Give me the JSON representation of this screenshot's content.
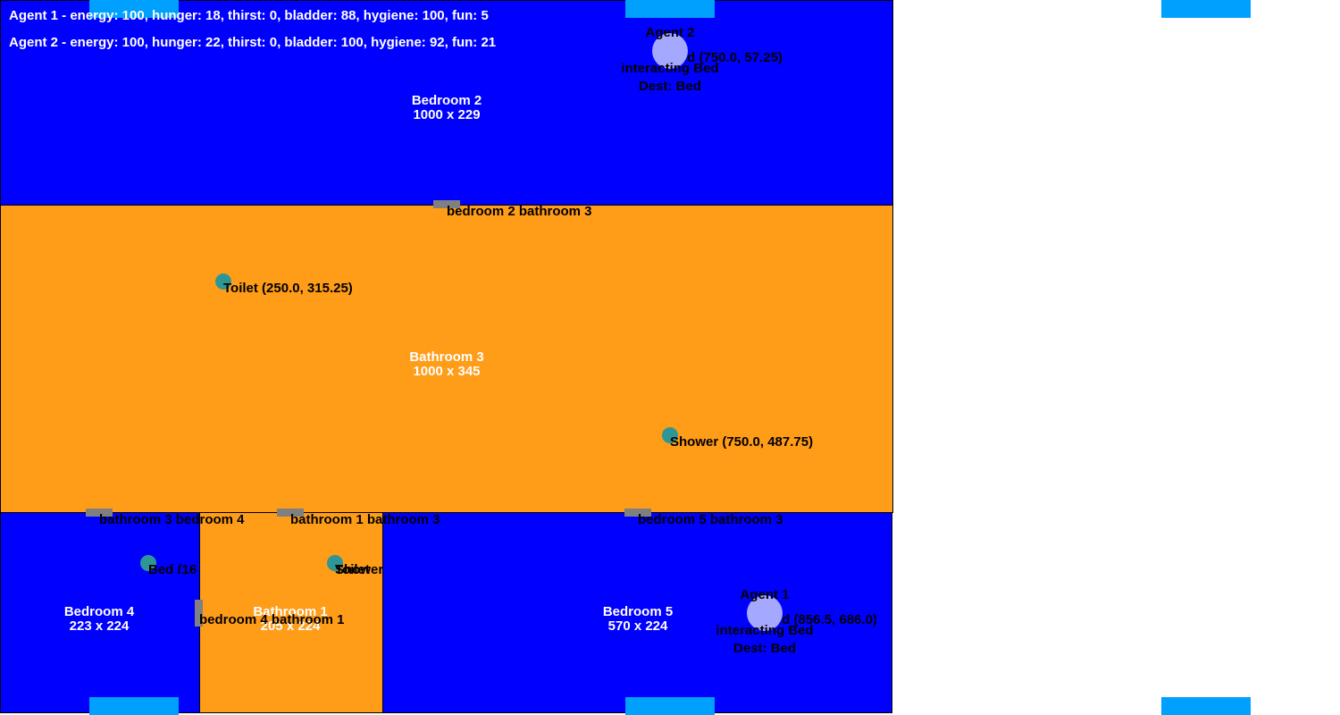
{
  "colors": {
    "bedroom": "#0000ff",
    "bathroom": "#ff9c18",
    "door": "#808080",
    "object": "#2e9796",
    "agent": "#a5a8ff",
    "window": "#00a0ff"
  },
  "hud": {
    "agent1": "Agent 1 - energy: 100, hunger: 18, thirst: 0, bladder: 88, hygiene: 100, fun: 5",
    "agent2": "Agent 2 - energy: 100, hunger: 22, thirst: 0, bladder: 100, hygiene: 92, fun: 21"
  },
  "rooms": {
    "bedroom2": {
      "name": "Bedroom 2",
      "size": "1000 x 229"
    },
    "bathroom3": {
      "name": "Bathroom 3",
      "size": "1000 x 345"
    },
    "bedroom4": {
      "name": "Bedroom 4",
      "size": "223 x 224"
    },
    "bathroom1": {
      "name": "Bathroom 1",
      "size": "205 x 224"
    },
    "bedroom5": {
      "name": "Bedroom 5",
      "size": "570 x 224"
    }
  },
  "doors": {
    "bedroom2_bathroom3": "bedroom 2 bathroom 3",
    "bathroom3_bedroom4": "bathroom 3 bedroom 4",
    "bathroom1_bathroom3": "bathroom 1 bathroom 3",
    "bedroom5_bathroom3": "bedroom 5 bathroom 3",
    "bedroom4_bathroom1": "bedroom 4 bathroom 1"
  },
  "objects": {
    "toilet": "Toilet (250.0, 315.25)",
    "shower": "Shower (750.0, 487.75)",
    "bed4": "Bed (16",
    "bath1_overlap_a": "Toilet",
    "bath1_overlap_b": "Shower",
    "bed2": "Bed (750.0, 57.25)",
    "bed5": "Bed (856.5, 686.0)"
  },
  "agents": {
    "agent1": {
      "name": "Agent 1",
      "state": "interacting Bed",
      "dest": "Dest: Bed"
    },
    "agent2": {
      "name": "Agent 2",
      "state": "interacting Bed",
      "dest": "Dest: Bed"
    }
  }
}
